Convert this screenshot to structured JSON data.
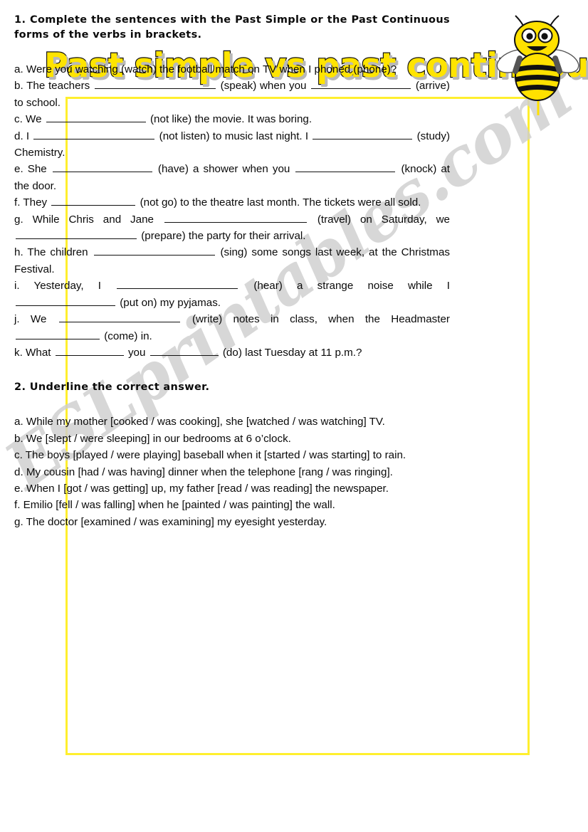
{
  "title": "Past simple vs past continuous",
  "watermark": "ESLprintables.com",
  "colors": {
    "title_fill": "#ffe400",
    "title_outline": "#101010",
    "box_border": "#ffef2e",
    "bee_yellow": "#ffe100",
    "bee_black": "#111111",
    "watermark_gray": "#cfcfcf"
  },
  "icons": {
    "bee": "bee-icon"
  },
  "exercise1": {
    "instruction": "1. Complete the sentences with the Past Simple or the Past Continuous forms of the verbs in brackets.",
    "items": [
      {
        "label": "a.",
        "segments": [
          "Were you watching (watch) the football match on TV when I phoned (phone)?"
        ]
      },
      {
        "label": "b.",
        "segments": [
          "The teachers ",
          "BLANK_XL",
          " (speak) when you ",
          "BLANK_LG",
          " (arrive) to school."
        ]
      },
      {
        "label": "c.",
        "segments": [
          "We ",
          "BLANK_LG",
          " (not like) the movie. It was boring."
        ]
      },
      {
        "label": "d.",
        "segments": [
          "I ",
          "BLANK_XL",
          " (not listen) to music last night. I ",
          "BLANK_LG",
          " (study) Chemistry."
        ]
      },
      {
        "label": "e.",
        "segments": [
          "She ",
          "BLANK_LG",
          " (have) a shower when you ",
          "BLANK_LG",
          " (knock) at the door."
        ]
      },
      {
        "label": "f.",
        "segments": [
          "They ",
          "BLANK_MD",
          " (not go) to the theatre last month. The tickets were all sold."
        ]
      },
      {
        "label": "g.",
        "segments": [
          "While Chris and Jane ",
          "BLANK_XXL",
          " (travel) on Saturday, we ",
          "BLANK_XL",
          " (prepare) the party for their arrival."
        ]
      },
      {
        "label": "h.",
        "segments": [
          "The children ",
          "BLANK_XL",
          " (sing) some songs last week, at the Christmas Festival."
        ]
      },
      {
        "label": "i.",
        "segments": [
          "Yesterday, I ",
          "BLANK_XL",
          " (hear) a strange noise while I ",
          "BLANK_LG",
          " (put on) my pyjamas."
        ]
      },
      {
        "label": "j.",
        "segments": [
          "We ",
          "BLANK_XL",
          " (write) notes in class, when the Headmaster ",
          "BLANK_MD",
          " (come) in."
        ]
      },
      {
        "label": "k.",
        "segments": [
          "What ",
          "BLANK_SM",
          " you ",
          "BLANK_SM",
          " (do) last Tuesday at 11 p.m.?"
        ]
      }
    ]
  },
  "exercise2": {
    "instruction": "2. Underline the correct answer.",
    "items": [
      {
        "label": "a.",
        "text": "While my mother [cooked / was cooking], she [watched / was watching] TV."
      },
      {
        "label": "b.",
        "text": "We [slept / were sleeping] in our bedrooms at 6 o’clock."
      },
      {
        "label": "c.",
        "text": "The boys [played / were playing] baseball when it [started / was starting] to rain."
      },
      {
        "label": "d.",
        "text": "My cousin [had / was having] dinner when the telephone [rang / was ringing]."
      },
      {
        "label": "e.",
        "text": "When I [got / was getting] up, my father [read / was reading] the newspaper."
      },
      {
        "label": "f.",
        "text": "Emilio [fell / was falling] when he [painted / was painting] the wall."
      },
      {
        "label": "g.",
        "text": "The doctor [examined / was examining] my eyesight yesterday."
      }
    ]
  }
}
